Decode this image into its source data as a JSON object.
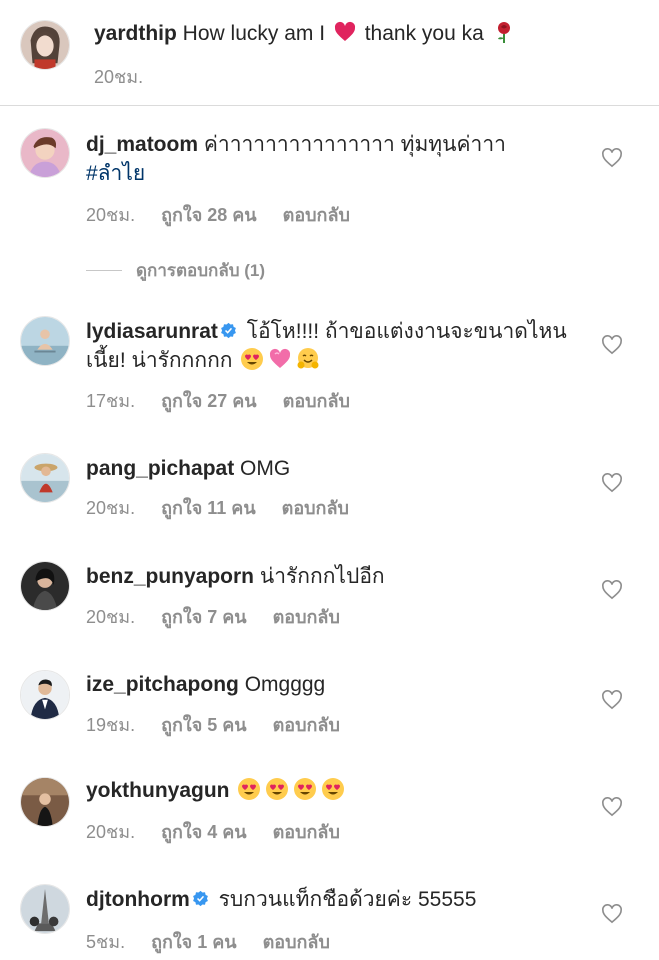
{
  "caption": {
    "username": "yardthip",
    "text": " How lucky am I ",
    "text2": " thank you ka ",
    "emoji1": "red-heart",
    "emoji2": "rose",
    "time": "20ชม."
  },
  "comments": [
    {
      "username": "dj_matoom",
      "text": " ค่าาาาาาาาาาาาาาา ทุ่มทุนค่าาา",
      "hashtag": "#ลำไย",
      "time": "20ชม.",
      "likes": "ถูกใจ 28 คน",
      "reply": "ตอบกลับ"
    },
    {
      "username": "lydiasarunrat",
      "verified": true,
      "text": " โอ้โห!!!! ถ้าขอแต่งงานจะขนาดไหนเนี้ย! น่ารักกกกก ",
      "emojis": [
        "heart-eyes",
        "pink-heart",
        "hugging-face"
      ],
      "time": "17ชม.",
      "likes": "ถูกใจ 27 คน",
      "reply": "ตอบกลับ"
    },
    {
      "username": "pang_pichapat",
      "text": " OMG",
      "time": "20ชม.",
      "likes": "ถูกใจ 11 คน",
      "reply": "ตอบกลับ"
    },
    {
      "username": "benz_punyaporn",
      "text": " น่ารักกกไปอีก",
      "time": "20ชม.",
      "likes": "ถูกใจ 7 คน",
      "reply": "ตอบกลับ"
    },
    {
      "username": "ize_pitchapong",
      "text": " Omgggg",
      "time": "19ชม.",
      "likes": "ถูกใจ 5 คน",
      "reply": "ตอบกลับ"
    },
    {
      "username": "yokthunyagun",
      "text": " ",
      "emojis": [
        "heart-eyes",
        "heart-eyes",
        "heart-eyes",
        "heart-eyes"
      ],
      "time": "20ชม.",
      "likes": "ถูกใจ 4 คน",
      "reply": "ตอบกลับ"
    },
    {
      "username": "djtonhorm",
      "verified": true,
      "text": " รบกวนแท็กชือด้วยค่ะ 55555",
      "time": "5ชม.",
      "likes": "ถูกใจ 1 คน",
      "reply": "ตอบกลับ"
    }
  ],
  "view_replies": "ดูการตอบกลับ (1)",
  "colors": {
    "text": "#262626",
    "secondary": "#8e8e8e",
    "hashtag": "#003569",
    "verified": "#3897f0",
    "divider": "#dbdbdb"
  },
  "icons": {
    "like": "heart-outline-icon",
    "verified": "verified-badge-icon"
  }
}
